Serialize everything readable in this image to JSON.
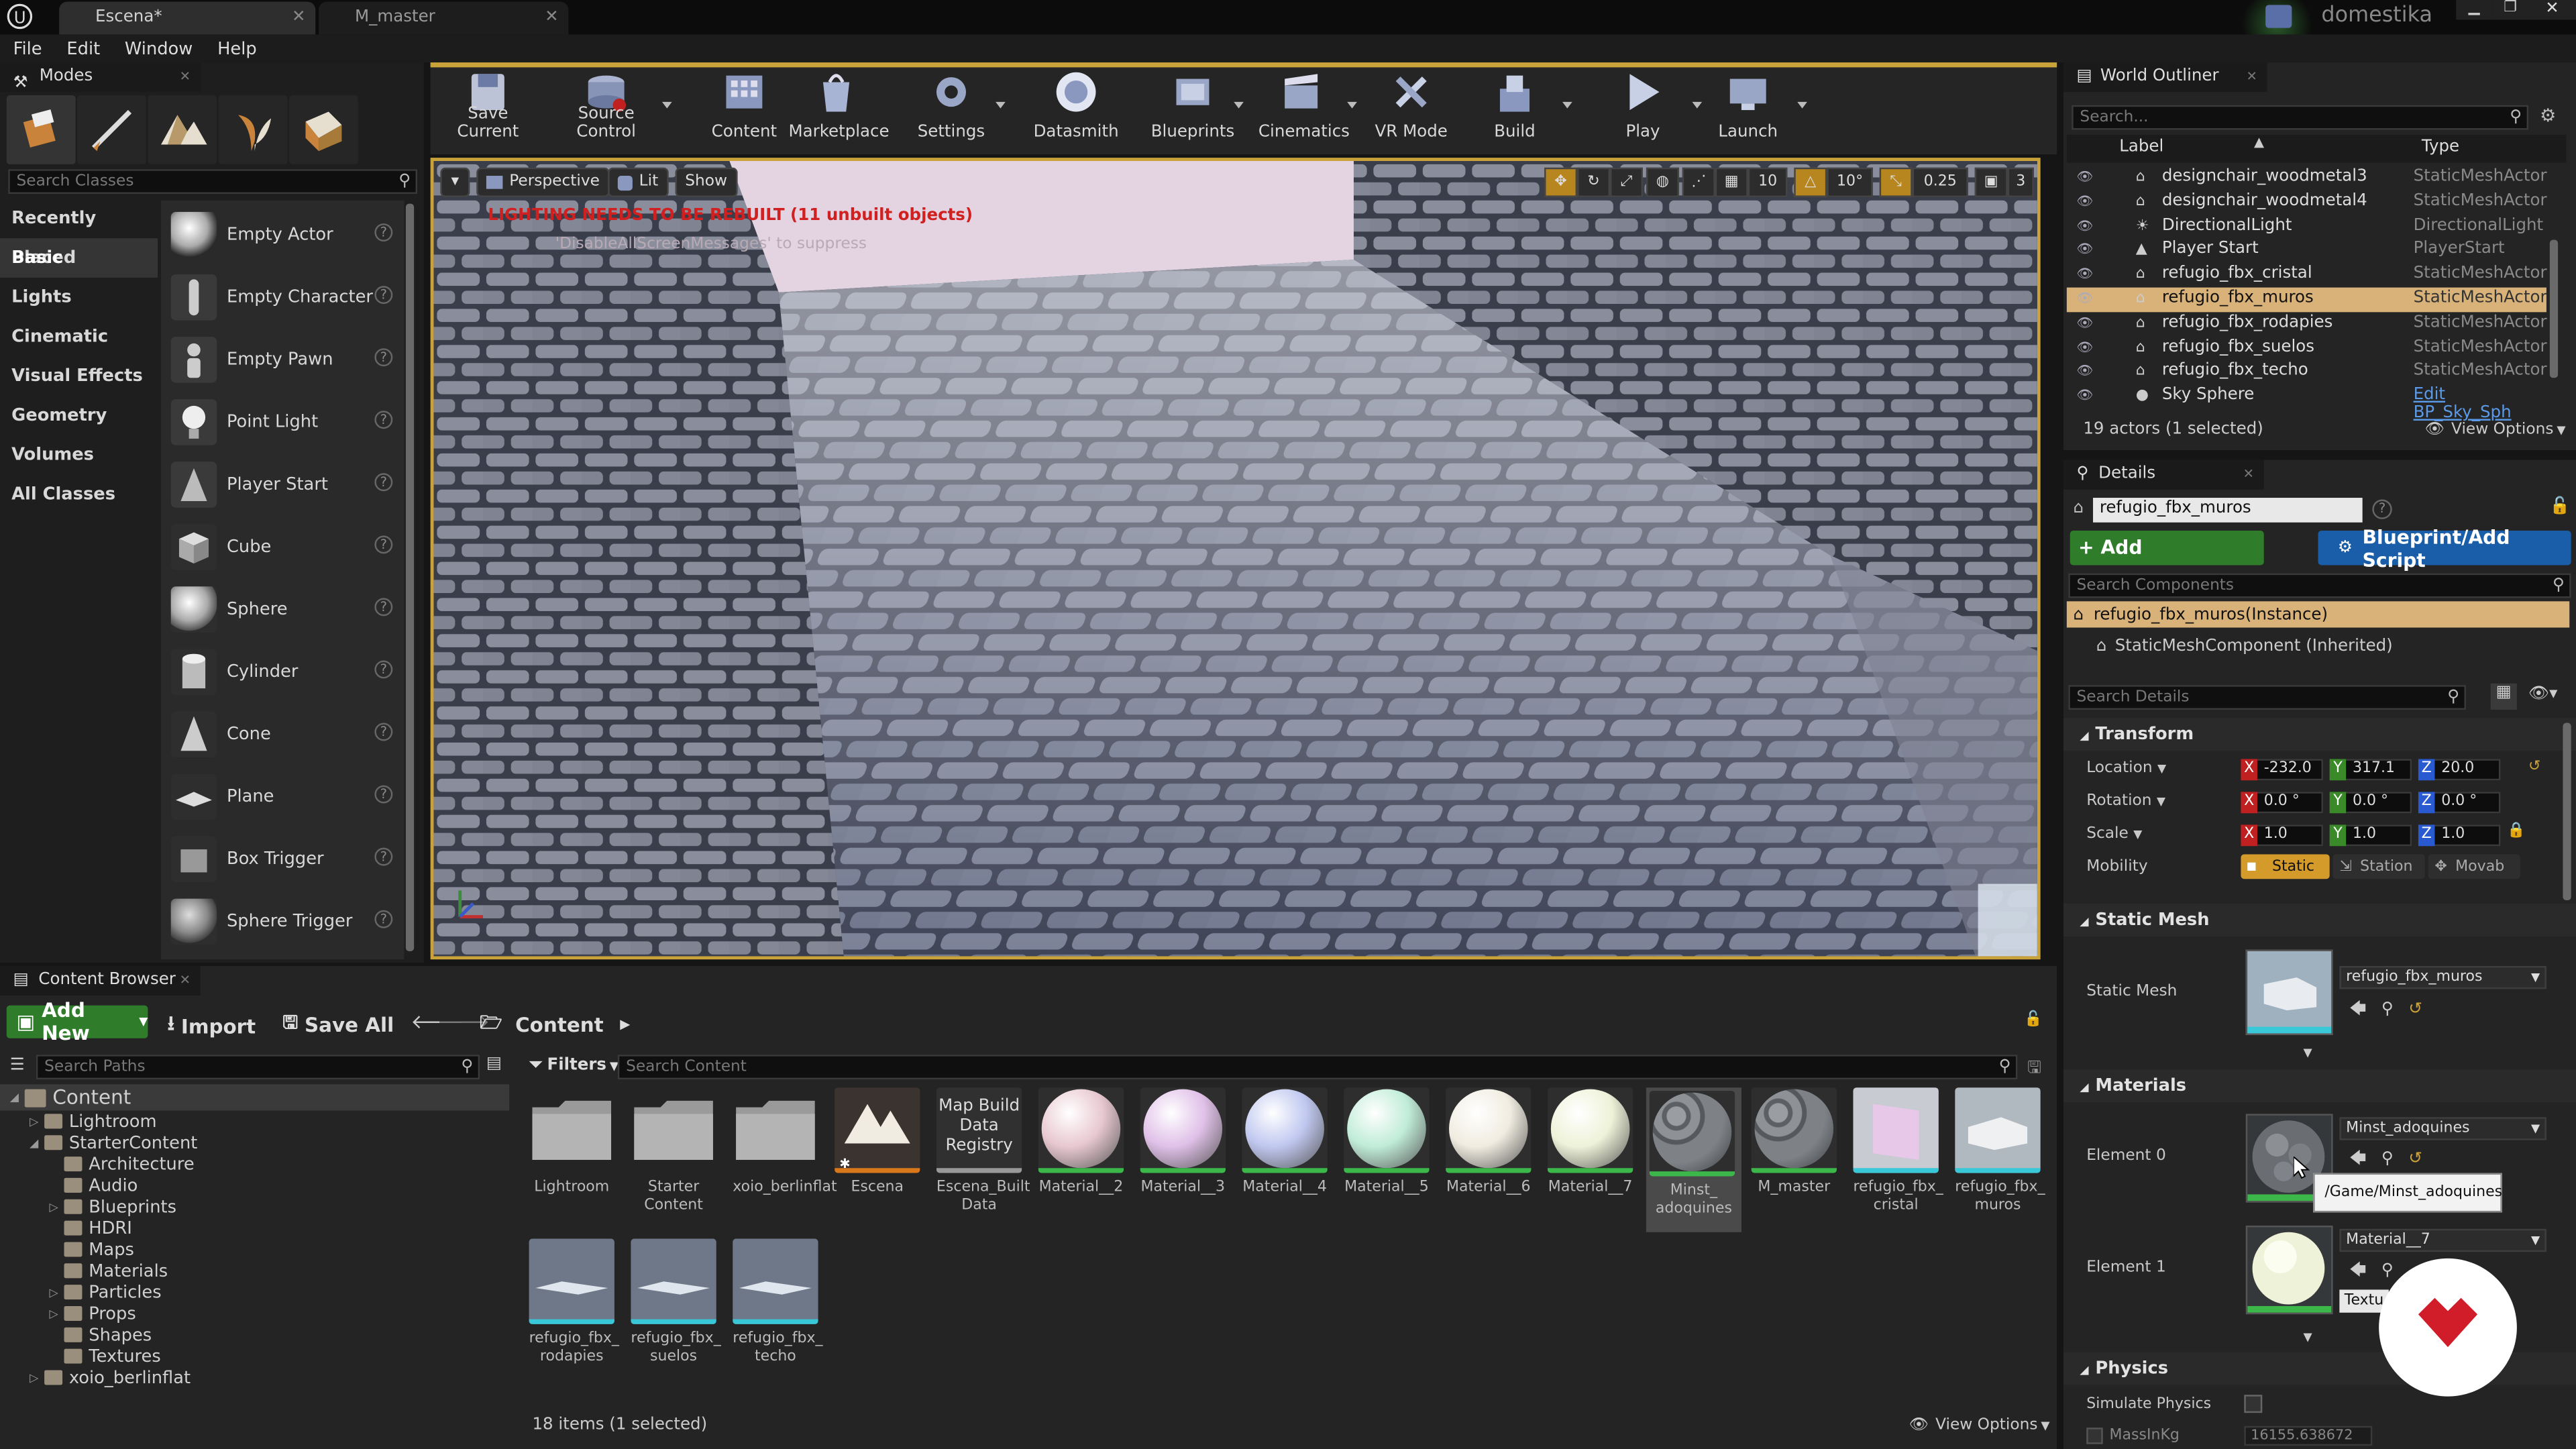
{
  "window": {
    "tabs": [
      "Escena*",
      "M_master"
    ],
    "user": "domestika",
    "controls": [
      "minimize",
      "maximize",
      "close"
    ]
  },
  "menu": [
    "File",
    "Edit",
    "Window",
    "Help"
  ],
  "modes": {
    "title": "Modes",
    "search_placeholder": "Search Classes",
    "categories": [
      "Recently Placed",
      "Basic",
      "Lights",
      "Cinematic",
      "Visual Effects",
      "Geometry",
      "Volumes",
      "All Classes"
    ],
    "selected_category": "Basic",
    "items": [
      "Empty Actor",
      "Empty Character",
      "Empty Pawn",
      "Point Light",
      "Player Start",
      "Cube",
      "Sphere",
      "Cylinder",
      "Cone",
      "Plane",
      "Box Trigger",
      "Sphere Trigger"
    ]
  },
  "toolbar": {
    "buttons": [
      "Save Current",
      "Source Control",
      "Content",
      "Marketplace",
      "Settings",
      "Datasmith",
      "Blueprints",
      "Cinematics",
      "VR Mode",
      "Build",
      "Play",
      "Launch"
    ]
  },
  "viewport": {
    "perspective": "Perspective",
    "lit": "Lit",
    "show": "Show",
    "warning": "LIGHTING NEEDS TO BE REBUILT (11 unbuilt objects)",
    "warning_sub": "'DisableAllScreenMessages' to suppress",
    "grid": "10",
    "rotation": "10°",
    "scale": "0.25",
    "camera_speed": "3"
  },
  "outliner": {
    "title": "World Outliner",
    "search_placeholder": "Search...",
    "col_label": "Label",
    "col_type": "Type",
    "rows": [
      {
        "name": "designchair_woodmetal3",
        "type": "StaticMeshActor"
      },
      {
        "name": "designchair_woodmetal4",
        "type": "StaticMeshActor"
      },
      {
        "name": "DirectionalLight",
        "type": "DirectionalLight"
      },
      {
        "name": "Player Start",
        "type": "PlayerStart"
      },
      {
        "name": "refugio_fbx_cristal",
        "type": "StaticMeshActor"
      },
      {
        "name": "refugio_fbx_muros",
        "type": "StaticMeshActor"
      },
      {
        "name": "refugio_fbx_rodapies",
        "type": "StaticMeshActor"
      },
      {
        "name": "refugio_fbx_suelos",
        "type": "StaticMeshActor"
      },
      {
        "name": "refugio_fbx_techo",
        "type": "StaticMeshActor"
      },
      {
        "name": "Sky Sphere",
        "type": "Edit BP_Sky_Sph"
      }
    ],
    "selected_row": "refugio_fbx_muros",
    "status": "19 actors (1 selected)",
    "view_options": "View Options"
  },
  "details": {
    "title": "Details",
    "name_value": "refugio_fbx_muros",
    "add_component": "+ Add Component",
    "blueprint": "Blueprint/Add Script",
    "search_components_placeholder": "Search Components",
    "instance": "refugio_fbx_muros(Instance)",
    "component": "StaticMeshComponent (Inherited)",
    "search_details_placeholder": "Search Details",
    "transform_title": "Transform",
    "location_label": "Location",
    "rotation_label": "Rotation",
    "scale_label": "Scale",
    "mobility_label": "Mobility",
    "location": {
      "x": "-232.0",
      "y": "317.1",
      "z": "20.0"
    },
    "rotation": {
      "x": "0.0 °",
      "y": "0.0 °",
      "z": "0.0 °"
    },
    "scale": {
      "x": "1.0",
      "y": "1.0",
      "z": "1.0"
    },
    "mobility": [
      "Static",
      "Station",
      "Movab"
    ],
    "static_mesh_title": "Static Mesh",
    "static_mesh_label": "Static Mesh",
    "static_mesh_value": "refugio_fbx_muros",
    "materials_title": "Materials",
    "element0_label": "Element 0",
    "element0_value": "Minst_adoquines",
    "tooltip": "/Game/Minst_adoquines",
    "element1_label": "Element 1",
    "element1_value": "Material__7",
    "element1_sub": "Textu",
    "physics_title": "Physics",
    "simulate_physics": "Simulate Physics",
    "mass_label": "MassInKg",
    "mass_value": "16155.638672"
  },
  "content_browser": {
    "title": "Content Browser",
    "add_new": "Add New",
    "import": "Import",
    "save_all": "Save All",
    "path": "Content",
    "search_paths_placeholder": "Search Paths",
    "filters": "Filters",
    "search_content_placeholder": "Search Content",
    "tree": [
      {
        "name": "Content",
        "level": 0
      },
      {
        "name": "Lightroom",
        "level": 1
      },
      {
        "name": "StarterContent",
        "level": 1
      },
      {
        "name": "Architecture",
        "level": 2
      },
      {
        "name": "Audio",
        "level": 2
      },
      {
        "name": "Blueprints",
        "level": 2
      },
      {
        "name": "HDRI",
        "level": 2
      },
      {
        "name": "Maps",
        "level": 2
      },
      {
        "name": "Materials",
        "level": 2
      },
      {
        "name": "Particles",
        "level": 2
      },
      {
        "name": "Props",
        "level": 2
      },
      {
        "name": "Shapes",
        "level": 2
      },
      {
        "name": "Textures",
        "level": 2
      },
      {
        "name": "xoio_berlinflat",
        "level": 1
      }
    ],
    "assets_row1": [
      {
        "label": "Lightroom",
        "kind": "folder"
      },
      {
        "label": "Starter Content",
        "kind": "folder"
      },
      {
        "label": "xoio_berlinflat",
        "kind": "folder"
      },
      {
        "label": "Escena",
        "kind": "level"
      },
      {
        "label": "Escena_Built Data",
        "kind": "builtdata",
        "thumb_text": "Map Build Data Registry"
      },
      {
        "label": "Material__2",
        "kind": "material",
        "color": "#e8c8d0"
      },
      {
        "label": "Material__3",
        "kind": "material",
        "color": "#e0c0e8"
      },
      {
        "label": "Material__4",
        "kind": "material",
        "color": "#c0c8f0"
      },
      {
        "label": "Material__5",
        "kind": "material",
        "color": "#c0ecd8"
      },
      {
        "label": "Material__6",
        "kind": "material",
        "color": "#f0ece0"
      },
      {
        "label": "Material__7",
        "kind": "material",
        "color": "#eef2d8"
      },
      {
        "label": "Minst_ adoquines",
        "kind": "stone"
      },
      {
        "label": "M_master",
        "kind": "stone"
      },
      {
        "label": "refugio_fbx_ cristal",
        "kind": "mesh-pink"
      },
      {
        "label": "refugio_fbx_ muros",
        "kind": "mesh"
      }
    ],
    "assets_row2": [
      {
        "label": "refugio_fbx_ rodapies",
        "kind": "mesh-flat"
      },
      {
        "label": "refugio_fbx_ suelos",
        "kind": "mesh-flat"
      },
      {
        "label": "refugio_fbx_ techo",
        "kind": "mesh-flat"
      }
    ],
    "status": "18 items (1 selected)",
    "view_options": "View Options"
  },
  "colors": {
    "accent_orange": "#c9a23a",
    "selection": "#d9b27a",
    "green_button": "#2f7d2a",
    "blue_button": "#1a5da8",
    "warning_red": "#d02020"
  }
}
